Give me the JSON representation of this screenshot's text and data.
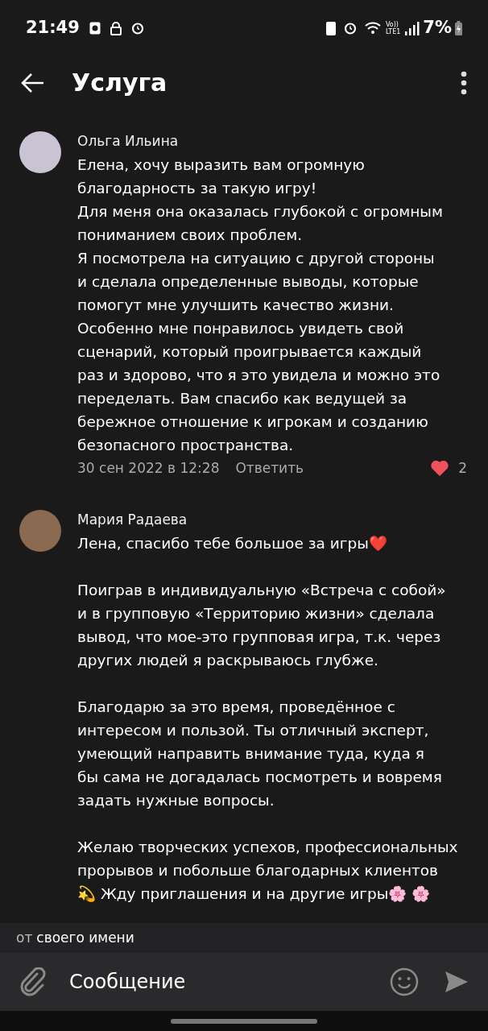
{
  "status_bar": {
    "time": "21:49",
    "volte": "Vo))",
    "network": "LTE1",
    "battery": "7%"
  },
  "header": {
    "title": "Услуга"
  },
  "comments": [
    {
      "author": "Ольга Ильина",
      "text": "Елена, хочу выразить вам огромную\nблагодарность за такую игру!\nДля меня она оказалась глубокой с огромным\nпониманием своих проблем.\nЯ посмотрела на ситуацию с другой стороны\nи сделала определенные выводы, которые\nпомогут мне улучшить качество жизни.\nОсобенно мне понравилось увидеть свой\nсценарий, который проигрывается каждый\nраз и здорово, что я это увидела и можно это\nпеределать. Вам спасибо как ведущей за\nбережное отношение к игрокам и созданию\nбезопасного пространства.",
      "date": "30 сен 2022 в 12:28",
      "reply": "Ответить",
      "liked": true,
      "likes": "2"
    },
    {
      "author": "Мария Радаева",
      "text": "Лена, спасибо тебе большое за игры❤️\n\nПоиграв в индивидуальную «Встреча с собой»\nи в групповую «Территорию жизни» сделала\nвывод, что мое-это групповая игра, т.к. через\nдругих людей я раскрываюсь глубже.\n\nБлагодарю за это время, проведённое с\nинтересом и пользой. Ты отличный эксперт,\nумеющий направить внимание туда, куда я\nбы сама не догадалась посмотреть и вовремя\nзадать нужные вопросы.\n\nЖелаю творческих успехов, профессиональных\nпрорывов и побольше благодарных клиентов\n💫 Жду приглашения и на другие игры🌸 🌸"
    }
  ],
  "sender": {
    "prefix": "от",
    "label": "своего имени"
  },
  "composer": {
    "placeholder": "Сообщение"
  }
}
